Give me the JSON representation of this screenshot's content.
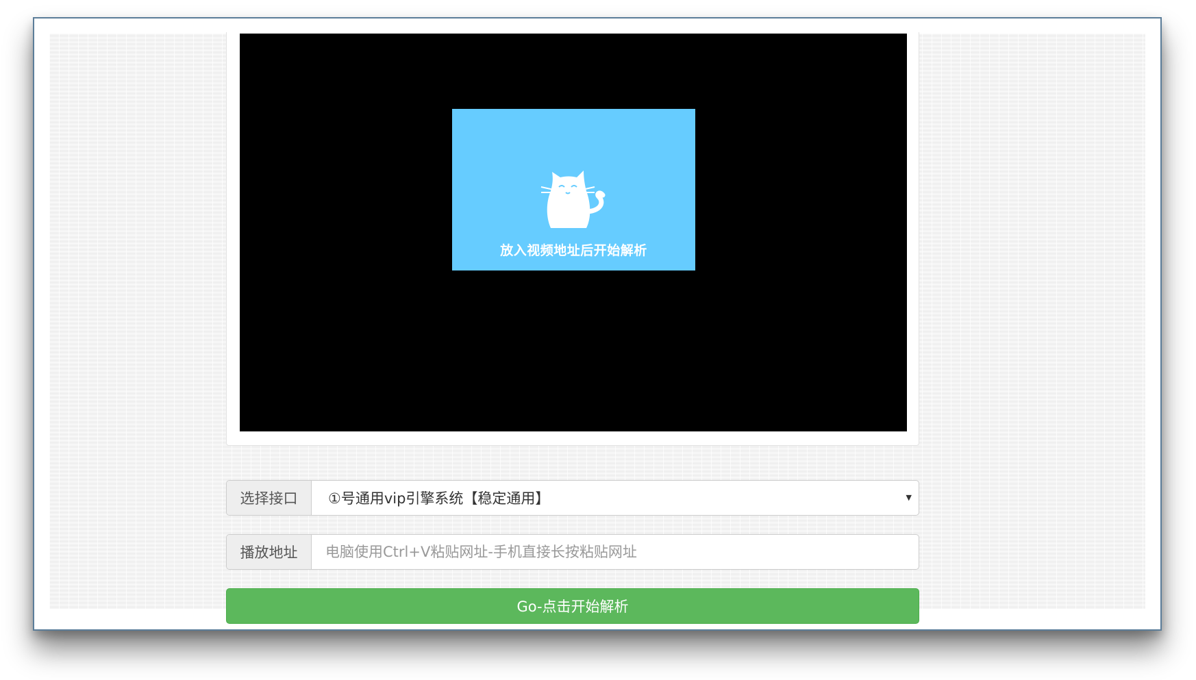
{
  "player": {
    "placeholder_text": "放入视频地址后开始解析",
    "poster_icon": "cat-icon",
    "poster_color": "#66ccff",
    "video_background": "#000000"
  },
  "interface_select": {
    "label": "选择接口",
    "selected": "①号通用vip引擎系统【稳定通用】",
    "caret_icon": "caret-down-icon"
  },
  "address": {
    "label": "播放地址",
    "placeholder": "电脑使用Ctrl+V粘贴网址-手机直接长按粘贴网址",
    "value": ""
  },
  "go_button": {
    "label": "Go-点击开始解析",
    "color": "#5cb85c"
  }
}
